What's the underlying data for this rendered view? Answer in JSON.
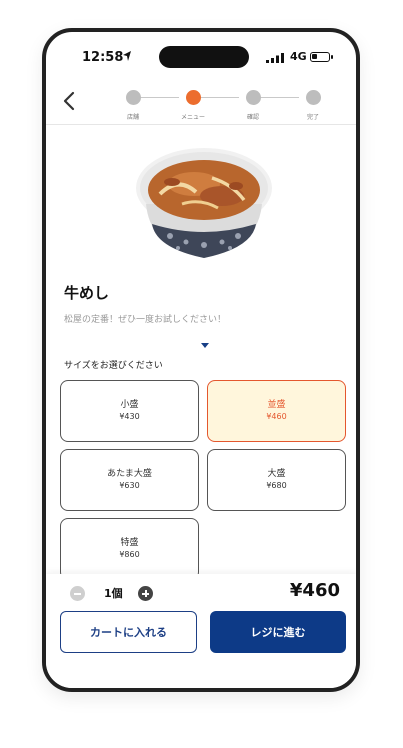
{
  "status_bar": {
    "time": "12:58",
    "network": "4G"
  },
  "steps": [
    {
      "label": "店舗"
    },
    {
      "label": "メニュー"
    },
    {
      "label": "確認"
    },
    {
      "label": "完了"
    }
  ],
  "product": {
    "name": "牛めし",
    "description": "松屋の定番！ぜひ一度お試しください！"
  },
  "size_section": {
    "prompt": "サイズをお選びください",
    "options": [
      {
        "name": "小盛",
        "price": "¥430"
      },
      {
        "name": "並盛",
        "price": "¥460"
      },
      {
        "name": "あたま大盛",
        "price": "¥630"
      },
      {
        "name": "大盛",
        "price": "¥680"
      },
      {
        "name": "特盛",
        "price": "¥860"
      }
    ],
    "selected": "並盛"
  },
  "cart": {
    "quantity": "1個",
    "total": "¥460",
    "add_to_cart_label": "カートに入れる",
    "checkout_label": "レジに進む"
  },
  "colors": {
    "accent": "#ec6d2e",
    "primary": "#0d3a87",
    "selected_bg": "#fff6dc"
  }
}
